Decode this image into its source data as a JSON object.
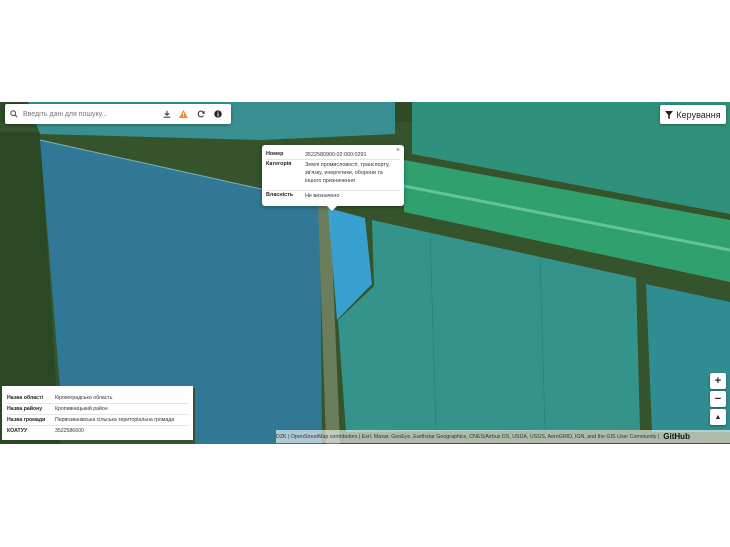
{
  "search": {
    "placeholder": "Введіть дані для пошуку..."
  },
  "toolbar": {
    "download_icon": "download-icon",
    "warning_icon": "warning-icon",
    "refresh_icon": "refresh-icon",
    "info_icon": "info-icon",
    "warning_color": "#f08a24"
  },
  "manage_button": {
    "label": "Керування"
  },
  "popup": {
    "close": "×",
    "rows": [
      {
        "key": "Номер",
        "value": "3522580900:02:000:0291"
      },
      {
        "key": "Категорія",
        "value": "Землі промисловості, транспорту, зв'язку, енергетики, оборони та іншого призначення"
      },
      {
        "key": "Власність",
        "value": "Не визначено"
      }
    ]
  },
  "info_panel": {
    "rows": [
      {
        "key": "Назва області",
        "value": "Кіровоградська область"
      },
      {
        "key": "Назва району",
        "value": "Кропивницький район"
      },
      {
        "key": "Назва громади",
        "value": "Первозванівська сільська територіальна громада"
      },
      {
        "key": "КОАТУУ",
        "value": "3522586600"
      }
    ]
  },
  "zoom": {
    "in": "+",
    "out": "−",
    "north": "▲"
  },
  "attribution": {
    "text": "DZK | OpenStreetMap contributors | Esri, Maxar, GeoEye, Earthstar Geographics, CNES/Airbus DS, USDA, USGS, AeroGRID, IGN, and the GIS User Community |",
    "github": "GitHub"
  },
  "colors": {
    "parcel_fill": "#2f8fbf",
    "selected_fill": "#38a9e0",
    "field": "#4a7a3a"
  }
}
